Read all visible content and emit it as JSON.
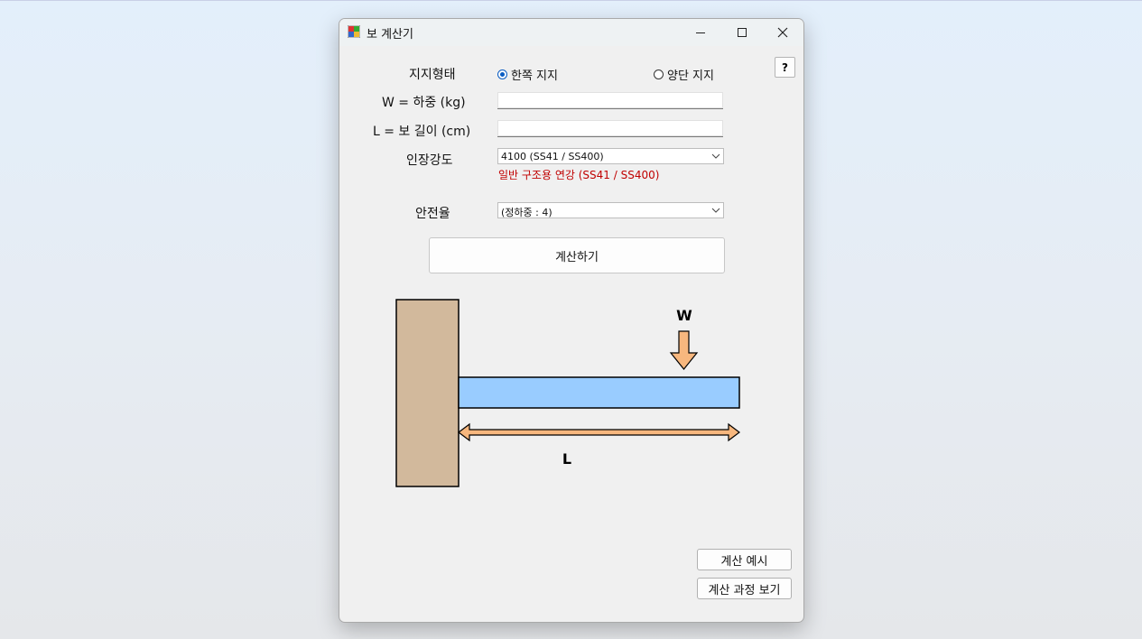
{
  "window": {
    "title": "보 계산기"
  },
  "form": {
    "support_label": "지지형태",
    "support_options": [
      "한쪽 지지",
      "양단 지지"
    ],
    "support_selected": 0,
    "load_label": "W = 하중 (kg)",
    "load_value": "",
    "length_label": "L = 보 길이 (cm)",
    "length_value": "",
    "strength_label": "인장강도",
    "strength_selected": "4100 (SS41 / SS400)",
    "strength_note": "일반 구조용 연강 (SS41 / SS400)",
    "safety_label": "안전율",
    "safety_selected": "(정하중 : 4)",
    "help_label": "?"
  },
  "buttons": {
    "calculate": "계산하기",
    "example": "계산 예시",
    "process": "계산 과정 보기"
  },
  "diagram": {
    "load_label": "W",
    "length_label": "L",
    "colors": {
      "wall": "#d2b99c",
      "beam": "#99ccff",
      "arrow": "#f7b77e"
    }
  }
}
